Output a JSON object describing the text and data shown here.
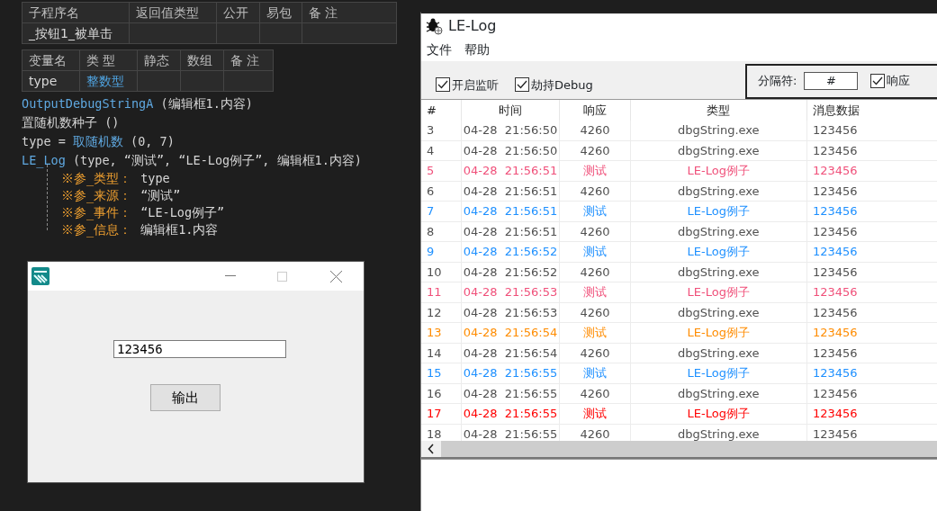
{
  "editor": {
    "sub_table": {
      "columns": [
        "子程序名",
        "返回值类型",
        "公开",
        "易包",
        "备 注"
      ],
      "rows": [
        {
          "name": "_按钮1_被单击"
        }
      ]
    },
    "var_table": {
      "columns": [
        "变量名",
        "类 型",
        "静态",
        "数组",
        "备 注"
      ],
      "rows": [
        {
          "name": "type",
          "type": "整数型"
        }
      ]
    },
    "code_lines": [
      {
        "tokens": [
          {
            "text": "OutputDebugStringA",
            "kind": "call"
          },
          {
            "text": " (编辑框1.内容)",
            "kind": "plain"
          }
        ]
      },
      {
        "tokens": [
          {
            "text": "置随机数种子 ()",
            "kind": "plain"
          }
        ]
      },
      {
        "tokens": [
          {
            "text": "type = ",
            "kind": "plain"
          },
          {
            "text": "取随机数",
            "kind": "call"
          },
          {
            "text": " (0, 7)",
            "kind": "plain"
          }
        ]
      },
      {
        "tokens": [
          {
            "text": "LE_Log",
            "kind": "call"
          },
          {
            "text": " (type, “测试”, “LE-Log例子”, 编辑框1.内容)",
            "kind": "plain"
          }
        ]
      }
    ],
    "call_params": [
      {
        "label": "※参_类型：",
        "value": "type"
      },
      {
        "label": "※参_来源：",
        "value": "“测试”"
      },
      {
        "label": "※参_事件：",
        "value": "“LE-Log例子”"
      },
      {
        "label": "※参_信息：",
        "value": "编辑框1.内容"
      }
    ]
  },
  "app_window": {
    "input_value": "123456",
    "button": "输出"
  },
  "log_window": {
    "title": "LE-Log",
    "menu": [
      "文件",
      "帮助"
    ],
    "options": [
      {
        "label": "开启监听",
        "checked": true
      },
      {
        "label": "劫持Debug",
        "checked": true
      }
    ],
    "separator": {
      "label": "分隔符:",
      "value": "#"
    },
    "filters": [
      {
        "label": "响应",
        "checked": true
      }
    ],
    "columns": [
      "#",
      "时间",
      "响应",
      "类型",
      "消息数据"
    ],
    "rows": [
      {
        "cells": [
          "3",
          "04-28  21:56:50",
          "4260",
          "dbgString.exe",
          "123456"
        ],
        "color": "#505050"
      },
      {
        "cells": [
          "4",
          "04-28  21:56:50",
          "4260",
          "dbgString.exe",
          "123456"
        ],
        "color": "#505050"
      },
      {
        "cells": [
          "5",
          "04-28  21:56:51",
          "测试",
          "LE-Log例子",
          "123456"
        ],
        "color": "#f0507a"
      },
      {
        "cells": [
          "6",
          "04-28  21:56:51",
          "4260",
          "dbgString.exe",
          "123456"
        ],
        "color": "#505050"
      },
      {
        "cells": [
          "7",
          "04-28  21:56:51",
          "测试",
          "LE-Log例子",
          "123456"
        ],
        "color": "#1e90ff"
      },
      {
        "cells": [
          "8",
          "04-28  21:56:51",
          "4260",
          "dbgString.exe",
          "123456"
        ],
        "color": "#505050"
      },
      {
        "cells": [
          "9",
          "04-28  21:56:52",
          "测试",
          "LE-Log例子",
          "123456"
        ],
        "color": "#1e90ff"
      },
      {
        "cells": [
          "10",
          "04-28  21:56:52",
          "4260",
          "dbgString.exe",
          "123456"
        ],
        "color": "#505050"
      },
      {
        "cells": [
          "11",
          "04-28  21:56:53",
          "测试",
          "LE-Log例子",
          "123456"
        ],
        "color": "#f0507a"
      },
      {
        "cells": [
          "12",
          "04-28  21:56:53",
          "4260",
          "dbgString.exe",
          "123456"
        ],
        "color": "#505050"
      },
      {
        "cells": [
          "13",
          "04-28  21:56:54",
          "测试",
          "LE-Log例子",
          "123456"
        ],
        "color": "#ff8c00"
      },
      {
        "cells": [
          "14",
          "04-28  21:56:54",
          "4260",
          "dbgString.exe",
          "123456"
        ],
        "color": "#505050"
      },
      {
        "cells": [
          "15",
          "04-28  21:56:55",
          "测试",
          "LE-Log例子",
          "123456"
        ],
        "color": "#1e90ff"
      },
      {
        "cells": [
          "16",
          "04-28  21:56:55",
          "4260",
          "dbgString.exe",
          "123456"
        ],
        "color": "#505050"
      },
      {
        "cells": [
          "17",
          "04-28  21:56:55",
          "测试",
          "LE-Log例子",
          "123456"
        ],
        "color": "#ff0000"
      },
      {
        "cells": [
          "18",
          "04-28  21:56:55",
          "4260",
          "dbgString.exe",
          "123456"
        ],
        "color": "#505050"
      }
    ]
  }
}
